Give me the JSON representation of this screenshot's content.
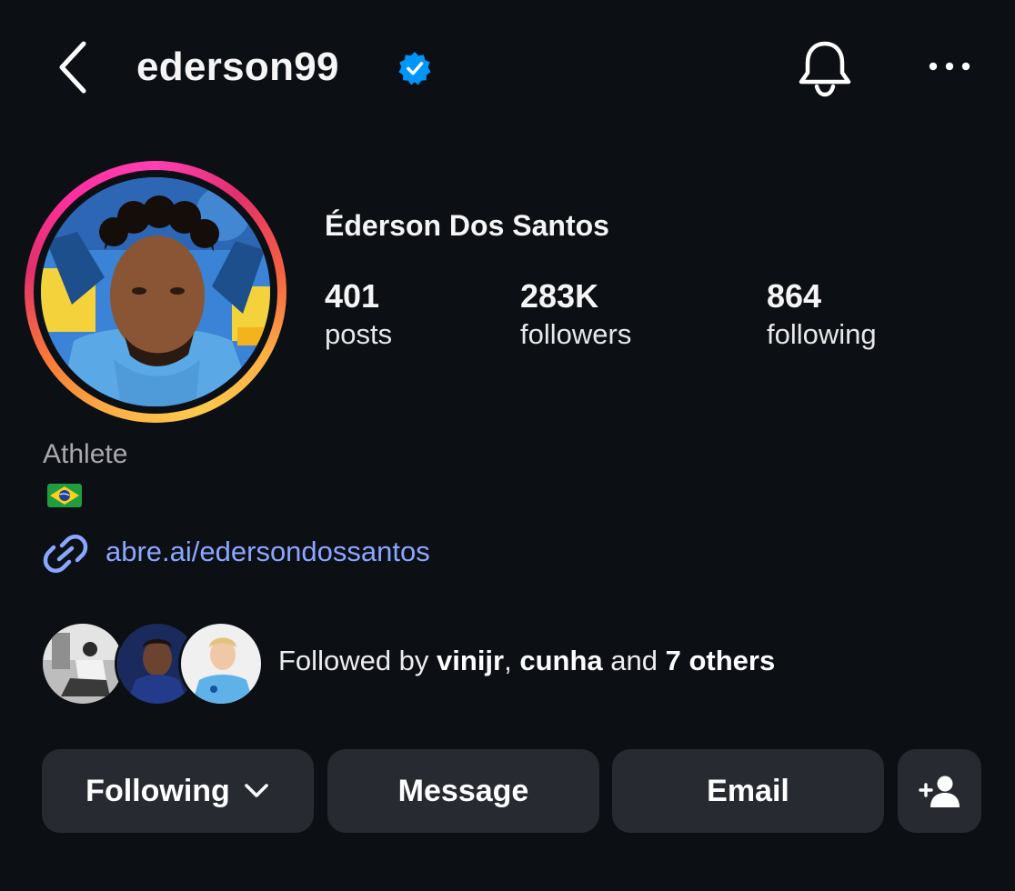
{
  "header": {
    "username": "ederson99"
  },
  "profile": {
    "full_name": "Éderson Dos Santos",
    "stats": [
      {
        "value": "401",
        "label": "posts"
      },
      {
        "value": "283K",
        "label": "followers"
      },
      {
        "value": "864",
        "label": "following"
      }
    ],
    "category": "Athlete",
    "flag": "Brazil flag emoji",
    "link": "abre.ai/edersondossantos"
  },
  "followed_by": {
    "prefix": "Followed by ",
    "user1": "vinijr",
    "separator": ", ",
    "user2": "cunha",
    "middle": " and ",
    "others": "7 others"
  },
  "buttons": {
    "following": "Following",
    "message": "Message",
    "email": "Email"
  },
  "icons": [
    "back-icon",
    "verified-icon",
    "bell-icon",
    "more-icon",
    "link-icon",
    "add-person-icon",
    "chevron-down-icon"
  ],
  "colors": {
    "background": "#0c0f14",
    "button": "#272a31",
    "link": "#8aa6ff",
    "verified": "#0095f6"
  }
}
